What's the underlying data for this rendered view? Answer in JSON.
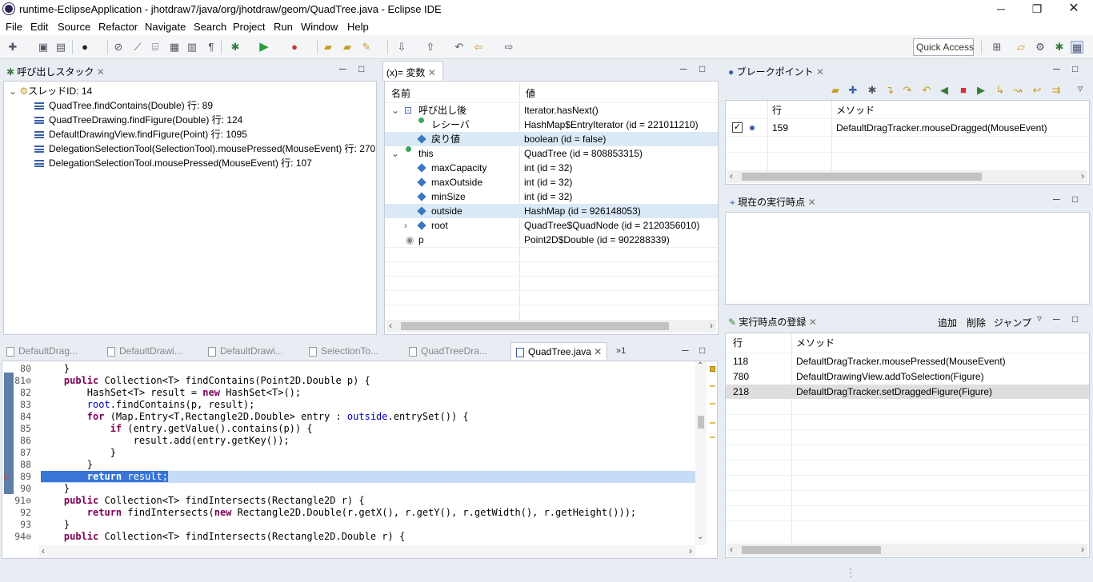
{
  "window": {
    "title": "runtime-EclipseApplication - jhotdraw7/java/org/jhotdraw/geom/QuadTree.java - Eclipse IDE"
  },
  "menu": [
    "File",
    "Edit",
    "Source",
    "Refactor",
    "Navigate",
    "Search",
    "Project",
    "Run",
    "Window",
    "Help"
  ],
  "quick_access": "Quick Access",
  "callstack": {
    "title": "呼び出しスタック",
    "thread": "スレッドID: 14",
    "frames": [
      "QuadTree.findContains(Double) 行: 89",
      "QuadTreeDrawing.findFigure(Double) 行: 124",
      "DefaultDrawingView.findFigure(Point) 行: 1095",
      "DelegationSelectionTool(SelectionTool).mousePressed(MouseEvent) 行: 270",
      "DelegationSelectionTool.mousePressed(MouseEvent) 行: 107"
    ]
  },
  "variables": {
    "title": "(x)= 変数",
    "col_name": "名前",
    "col_value": "値",
    "rows": [
      {
        "name": "呼び出し後",
        "value": "Iterator.hasNext()"
      },
      {
        "name": "レシーバ",
        "value": "HashMap$EntryIterator (id = 221011210)"
      },
      {
        "name": "戻り値",
        "value": "boolean (id = false)"
      },
      {
        "name": "this",
        "value": "QuadTree (id = 808853315)"
      },
      {
        "name": "maxCapacity",
        "value": "int (id = 32)"
      },
      {
        "name": "maxOutside",
        "value": "int (id = 32)"
      },
      {
        "name": "minSize",
        "value": "int (id = 32)"
      },
      {
        "name": "outside",
        "value": "HashMap (id = 926148053)"
      },
      {
        "name": "root",
        "value": "QuadTree$QuadNode (id = 2120356010)"
      },
      {
        "name": "p",
        "value": "Point2D$Double (id = 902288339)"
      }
    ]
  },
  "breakpoints": {
    "title": "ブレークポイント",
    "col_line": "行",
    "col_method": "メソッド",
    "rows": [
      {
        "line": "159",
        "method": "DefaultDragTracker.mouseDragged(MouseEvent)"
      }
    ]
  },
  "current": {
    "title": "現在の実行時点"
  },
  "registry": {
    "title": "実行時点の登録",
    "add": "追加",
    "delete": "削除",
    "jump": "ジャンプ",
    "col_line": "行",
    "col_method": "メソッド",
    "rows": [
      {
        "line": "118",
        "method": "DefaultDragTracker.mousePressed(MouseEvent)"
      },
      {
        "line": "780",
        "method": "DefaultDrawingView.addToSelection(Figure)"
      },
      {
        "line": "218",
        "method": "DefaultDragTracker.setDraggedFigure(Figure)"
      }
    ]
  },
  "editor": {
    "tabs": [
      "DefaultDrag...",
      "DefaultDrawi...",
      "DefaultDrawi...",
      "SelectionTo...",
      "QuadTreeDra...",
      "QuadTree.java"
    ],
    "overflow": "»1",
    "lines": [
      {
        "n": "80",
        "t": "    }"
      },
      {
        "n": "81⊖",
        "t": "    public Collection<T> findContains(Point2D.Double p) {"
      },
      {
        "n": "82",
        "t": "        HashSet<T> result = new HashSet<T>();"
      },
      {
        "n": "83",
        "t": "        root.findContains(p, result);"
      },
      {
        "n": "84",
        "t": "        for (Map.Entry<T,Rectangle2D.Double> entry : outside.entrySet()) {"
      },
      {
        "n": "85",
        "t": "            if (entry.getValue().contains(p)) {"
      },
      {
        "n": "86",
        "t": "                result.add(entry.getKey());"
      },
      {
        "n": "87",
        "t": "            }"
      },
      {
        "n": "88",
        "t": "        }"
      },
      {
        "n": "89",
        "t": "        return result;"
      },
      {
        "n": "90",
        "t": "    }"
      },
      {
        "n": "91⊖",
        "t": "    public Collection<T> findIntersects(Rectangle2D r) {"
      },
      {
        "n": "92",
        "t": "        return findIntersects(new Rectangle2D.Double(r.getX(), r.getY(), r.getWidth(), r.getHeight()));"
      },
      {
        "n": "93",
        "t": "    }"
      },
      {
        "n": "94⊖",
        "t": "    public Collection<T> findIntersects(Rectangle2D.Double r) {"
      }
    ]
  }
}
